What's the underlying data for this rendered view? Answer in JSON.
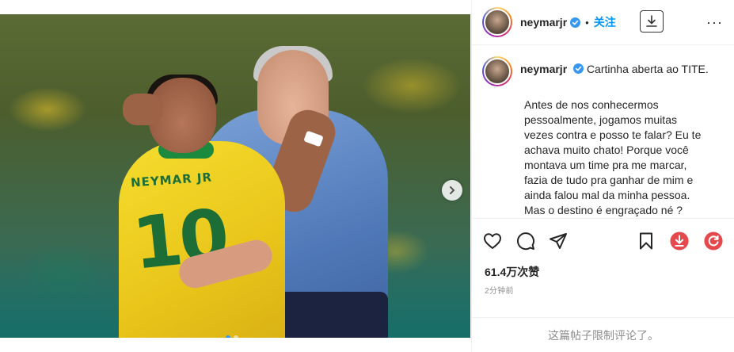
{
  "post": {
    "username": "neymarjr",
    "separator": "•",
    "follow_label": "关注",
    "more_label": "···",
    "caption_title": "Cartinha aberta ao TITE.",
    "caption_body": "Antes de nos conhecermos\npessoalmente, jogamos muitas\nvezes contra e posso te falar? Eu te\nachava muito chato! Porque você\nmontava um time pra me marcar,\nfazia de tudo pra ganhar de mim e\nainda falou mal da minha pessoa.\nMas o destino é engraçado né ?\nColocou você como treinador e eu",
    "likes": "61.4万次赞",
    "time_ago": "2分钟前",
    "comments_limited": "这篇帖子限制评论了。",
    "media": {
      "jersey_name": "NEYMAR JR",
      "jersey_number": "10",
      "carousel_count": 2,
      "carousel_index": 0
    }
  },
  "icons": {
    "verified": "verified-badge-icon",
    "download": "download-icon",
    "like": "heart-icon",
    "comment": "comment-icon",
    "share": "share-icon",
    "save": "bookmark-icon",
    "ext_download": "red-download-icon",
    "ext_refresh": "red-refresh-icon"
  },
  "colors": {
    "follow_blue": "#0095f6",
    "verified_blue": "#3897f0",
    "ext_red": "#e5484d"
  }
}
